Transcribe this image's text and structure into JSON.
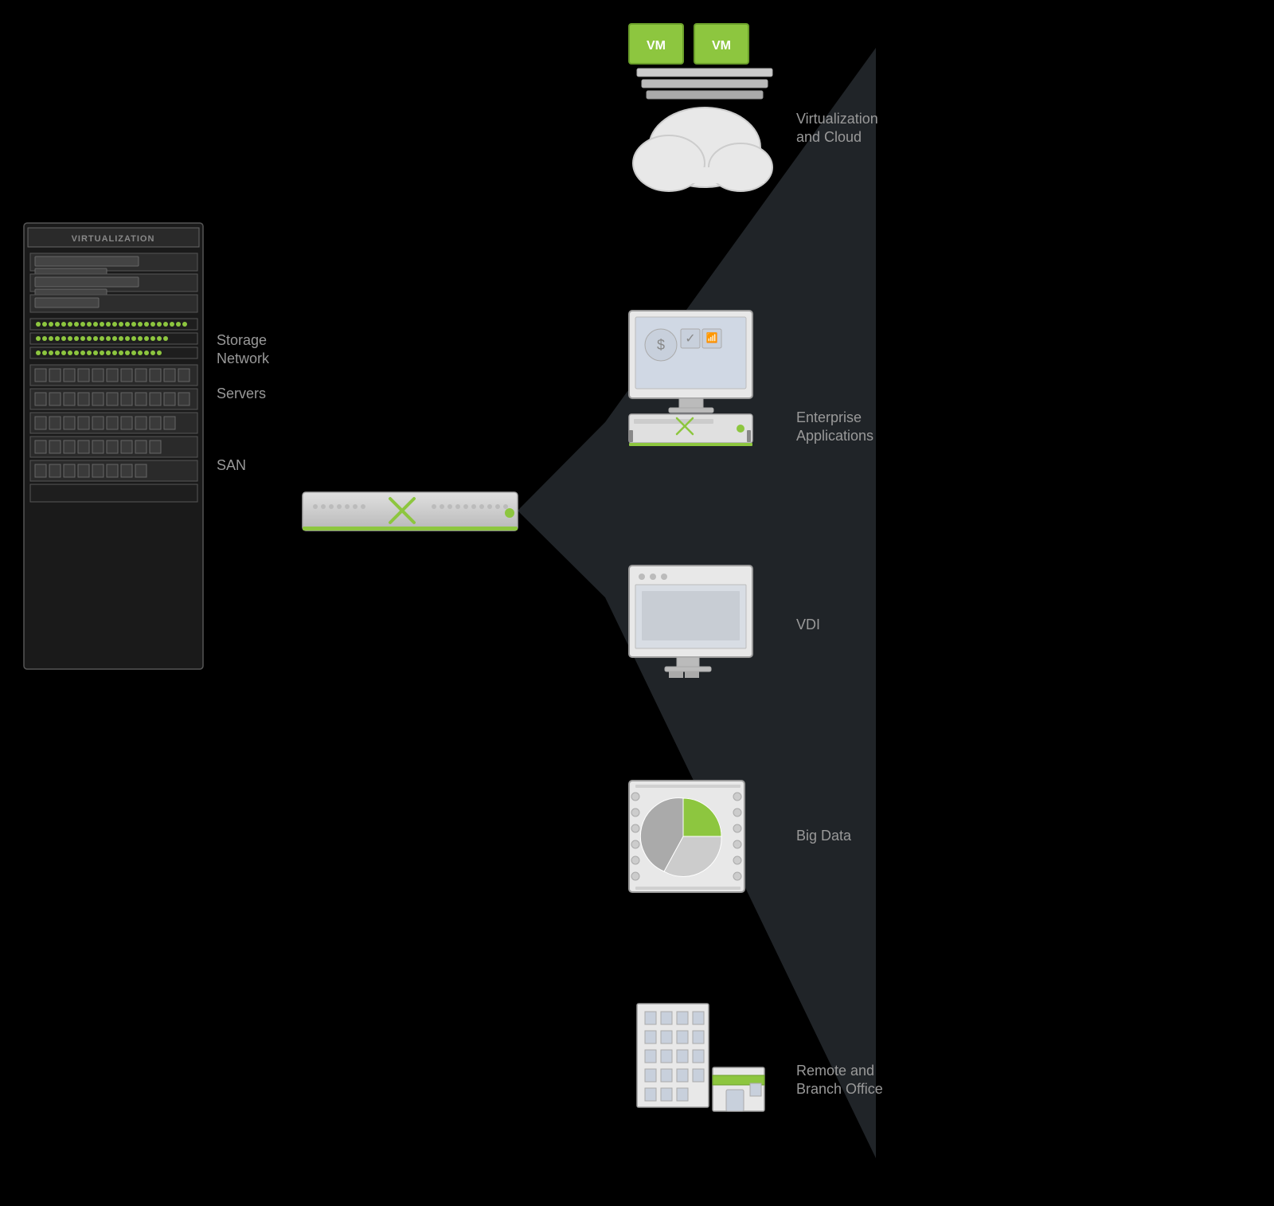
{
  "background": "#000000",
  "labels": {
    "servers": "Servers",
    "storage_network": "Storage\nNetwork",
    "san": "SAN",
    "virtualization_cloud": "Virtualization\nand Cloud",
    "enterprise_applications": "Enterprise\nApplications",
    "vdi": "VDI",
    "big_data": "Big Data",
    "remote_branch_office": "Remote and\nBranch Office"
  },
  "rack": {
    "top_label": "VIRTUALIZATION"
  },
  "colors": {
    "green": "#8dc63f",
    "gray_light": "#d0d0d0",
    "gray_medium": "#999999",
    "text_color": "#999999",
    "rack_bg": "#2a2a2a",
    "rack_border": "#555555"
  },
  "vm_labels": [
    "VM",
    "VM"
  ]
}
